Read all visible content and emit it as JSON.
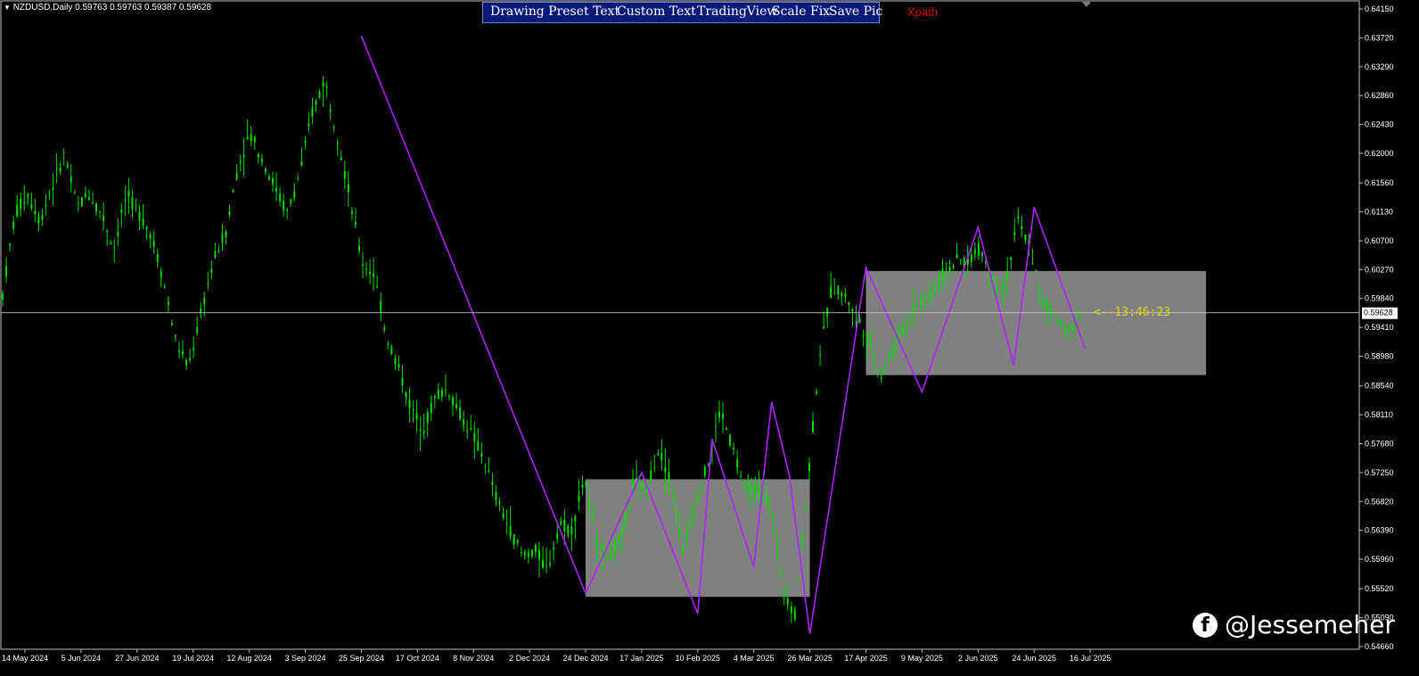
{
  "header": {
    "symbol_line": "NZDUSD,Daily  0.59763 0.59763 0.59387 0.59628"
  },
  "toolbar": {
    "drawing_preset_text": "Drawing Preset Text",
    "custom_text": "Custom Text",
    "tradingview": "TradingView",
    "scale_fix": "Scale Fix",
    "save_pic": "Save Pic",
    "xpath": "Xpath"
  },
  "countdown": "<--13:46:23",
  "current_price_label": "0.59628",
  "watermark": {
    "icon": "facebook-icon",
    "handle": "@Jessemeher"
  },
  "colors": {
    "background": "#000000",
    "candles": "#00e000",
    "zigzag": "#b020ff",
    "zone": "#808080",
    "price_line": "#c0c0c0",
    "countdown": "#e8d800",
    "xpath": "#e00000",
    "toolbar_bg": "#0a1a78"
  },
  "chart_data": {
    "type": "line",
    "symbol": "NZDUSD",
    "timeframe": "Daily",
    "ylim": [
      0.5466,
      0.6415
    ],
    "y_ticks": [
      "0.64150",
      "0.63720",
      "0.63290",
      "0.62860",
      "0.62430",
      "0.62000",
      "0.61560",
      "0.61130",
      "0.60700",
      "0.60270",
      "0.59840",
      "0.59410",
      "0.58980",
      "0.58540",
      "0.58110",
      "0.57680",
      "0.57250",
      "0.56820",
      "0.56390",
      "0.55960",
      "0.55520",
      "0.55090",
      "0.54660"
    ],
    "x_ticks": [
      "14 May 2024",
      "5 Jun 2024",
      "27 Jun 2024",
      "19 Jul 2024",
      "12 Aug 2024",
      "3 Sep 2024",
      "25 Sep 2024",
      "17 Oct 2024",
      "8 Nov 2024",
      "2 Dec 2024",
      "24 Dec 2024",
      "17 Jan 2025",
      "10 Feb 2025",
      "4 Mar 2025",
      "26 Mar 2025",
      "17 Apr 2025",
      "9 May 2025",
      "2 Jun 2025",
      "24 Jun 2025",
      "16 Jul 2025"
    ],
    "series": [
      {
        "values": [
          0.599,
          0.611,
          0.614,
          0.61,
          0.615,
          0.62,
          0.612,
          0.614,
          0.611,
          0.606,
          0.614,
          0.611,
          0.608,
          0.601,
          0.592,
          0.588,
          0.596,
          0.604,
          0.608,
          0.618,
          0.623,
          0.619,
          0.615,
          0.611,
          0.617,
          0.626,
          0.631,
          0.623,
          0.614,
          0.604,
          0.602,
          0.593,
          0.588,
          0.582,
          0.579,
          0.584,
          0.585,
          0.581,
          0.578,
          0.574,
          0.568,
          0.564,
          0.56,
          0.561,
          0.558,
          0.565,
          0.564,
          0.572,
          0.562,
          0.56,
          0.563,
          0.571,
          0.57,
          0.576,
          0.571,
          0.561,
          0.568,
          0.574,
          0.582,
          0.576,
          0.57,
          0.57,
          0.568,
          0.556,
          0.551,
          0.57,
          0.59,
          0.6,
          0.599,
          0.596,
          0.592,
          0.587,
          0.591,
          0.595,
          0.598,
          0.599,
          0.602,
          0.604,
          0.604,
          0.606,
          0.601,
          0.6,
          0.61,
          0.606,
          0.598,
          0.596,
          0.593,
          0.5963
        ]
      }
    ],
    "zigzag": [
      {
        "date": "25 Sep 2024",
        "price": 0.6375
      },
      {
        "date": "24 Dec 2024",
        "price": 0.5545
      },
      {
        "date": "17 Jan 2025",
        "price": 0.5725
      },
      {
        "date": "10 Feb 2025",
        "price": 0.5515
      },
      {
        "date": "17 Feb 2025",
        "price": 0.5775
      },
      {
        "date": "4 Mar 2025",
        "price": 0.5585
      },
      {
        "date": "12 Mar 2025",
        "price": 0.583
      },
      {
        "date": "18 Mar 2025",
        "price": 0.572
      },
      {
        "date": "26 Mar 2025",
        "price": 0.5485
      },
      {
        "date": "17 Apr 2025",
        "price": 0.603
      },
      {
        "date": "9 May 2025",
        "price": 0.5845
      },
      {
        "date": "2 Jun 2025",
        "price": 0.609
      },
      {
        "date": "17 Jun 2025",
        "price": 0.5885
      },
      {
        "date": "24 Jun 2025",
        "price": 0.612
      },
      {
        "date": "14 Jul 2025",
        "price": 0.591
      }
    ],
    "zones": [
      {
        "from_date": "24 Dec 2024",
        "to_date": "26 Mar 2025",
        "top": 0.5715,
        "bottom": 0.554
      },
      {
        "from_date": "17 Apr 2025",
        "to_date": "24 Jul 2025",
        "top": 0.6025,
        "bottom": 0.587
      }
    ],
    "current_price": 0.59628,
    "grid": false
  }
}
